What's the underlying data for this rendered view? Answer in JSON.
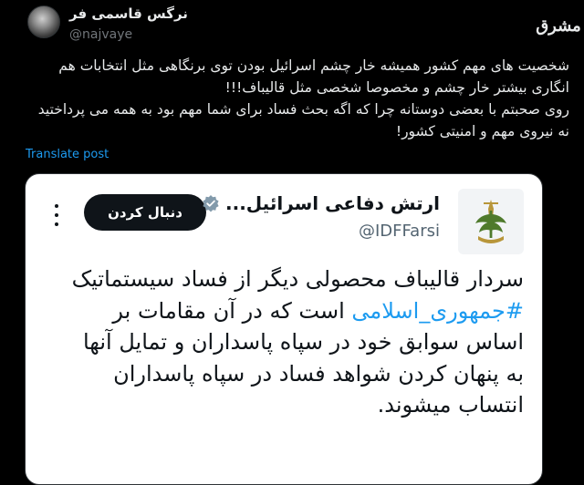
{
  "post": {
    "author_name": "نرگس قاسمی فر",
    "author_handle": "@najvaye",
    "paragraph_1": "شخصیت های مهم کشور همیشه خار چشم اسرائیل بودن توی برنگاهی مثل انتخابات هم انگاری بیشتر خار چشم و مخصوصا شخصی مثل قالیباف!!!",
    "paragraph_2": "روی صحبتم با بعضی دوستانه چرا که اگه بحث فساد برای شما مهم بود به همه می پرداختید نه نیروی مهم و امنیتی کشور!",
    "translate_label": "Translate post"
  },
  "site_logo": {
    "text": "مشرق",
    "icon": "mashregh-logo-icon"
  },
  "quoted": {
    "account_name": "ارتش دفاعی اسرائیل...",
    "handle": "@IDFFarsi",
    "follow_label": "دنبال کردن",
    "body_part_1": "سردار قالیباف محصولی دیگر از فساد سیستماتیک",
    "hashtag": "#جمهوری_اسلامی",
    "body_part_2": "است که در آن مقامات بر اساس سوابق خود در سپاه پاسداران و تمایل آنها به پنهان کردن شواهد فساد در سپاه پاسداران انتساب میشوند.",
    "verified_icon": "verified-badge-icon",
    "logo_icon": "idf-emblem-icon",
    "more_icon": "more-options-icon"
  },
  "colors": {
    "background": "#000000",
    "link": "#1d9bf0",
    "card_background": "#ffffff",
    "follow_button": "#0f1419"
  }
}
